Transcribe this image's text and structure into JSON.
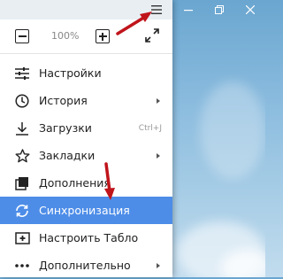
{
  "zoom": {
    "value": "100%"
  },
  "menu_items": [
    {
      "label": "Настройки",
      "has_submenu": false
    },
    {
      "label": "История",
      "has_submenu": true
    },
    {
      "label": "Загрузки",
      "has_submenu": false,
      "shortcut": "Ctrl+J"
    },
    {
      "label": "Закладки",
      "has_submenu": true
    },
    {
      "label": "Дополнения",
      "has_submenu": false
    },
    {
      "label": "Синхронизация",
      "has_submenu": false,
      "selected": true
    },
    {
      "label": "Настроить Табло",
      "has_submenu": false
    },
    {
      "label": "Дополнительно",
      "has_submenu": true
    }
  ],
  "icons": {
    "menu": "hamburger-icon",
    "zoom_out": "minus-box-icon",
    "zoom_in": "plus-box-icon",
    "fullscreen": "expand-arrows-icon",
    "settings": "sliders-icon",
    "history": "clock-icon",
    "downloads": "download-icon",
    "bookmarks": "star-icon",
    "extensions": "extensions-icon",
    "sync": "sync-icon",
    "tableau": "add-tile-icon",
    "more": "ellipsis-icon"
  },
  "colors": {
    "highlight": "#4d8de8",
    "annotation_arrow": "#c0141b",
    "header": "#e9eef3"
  }
}
